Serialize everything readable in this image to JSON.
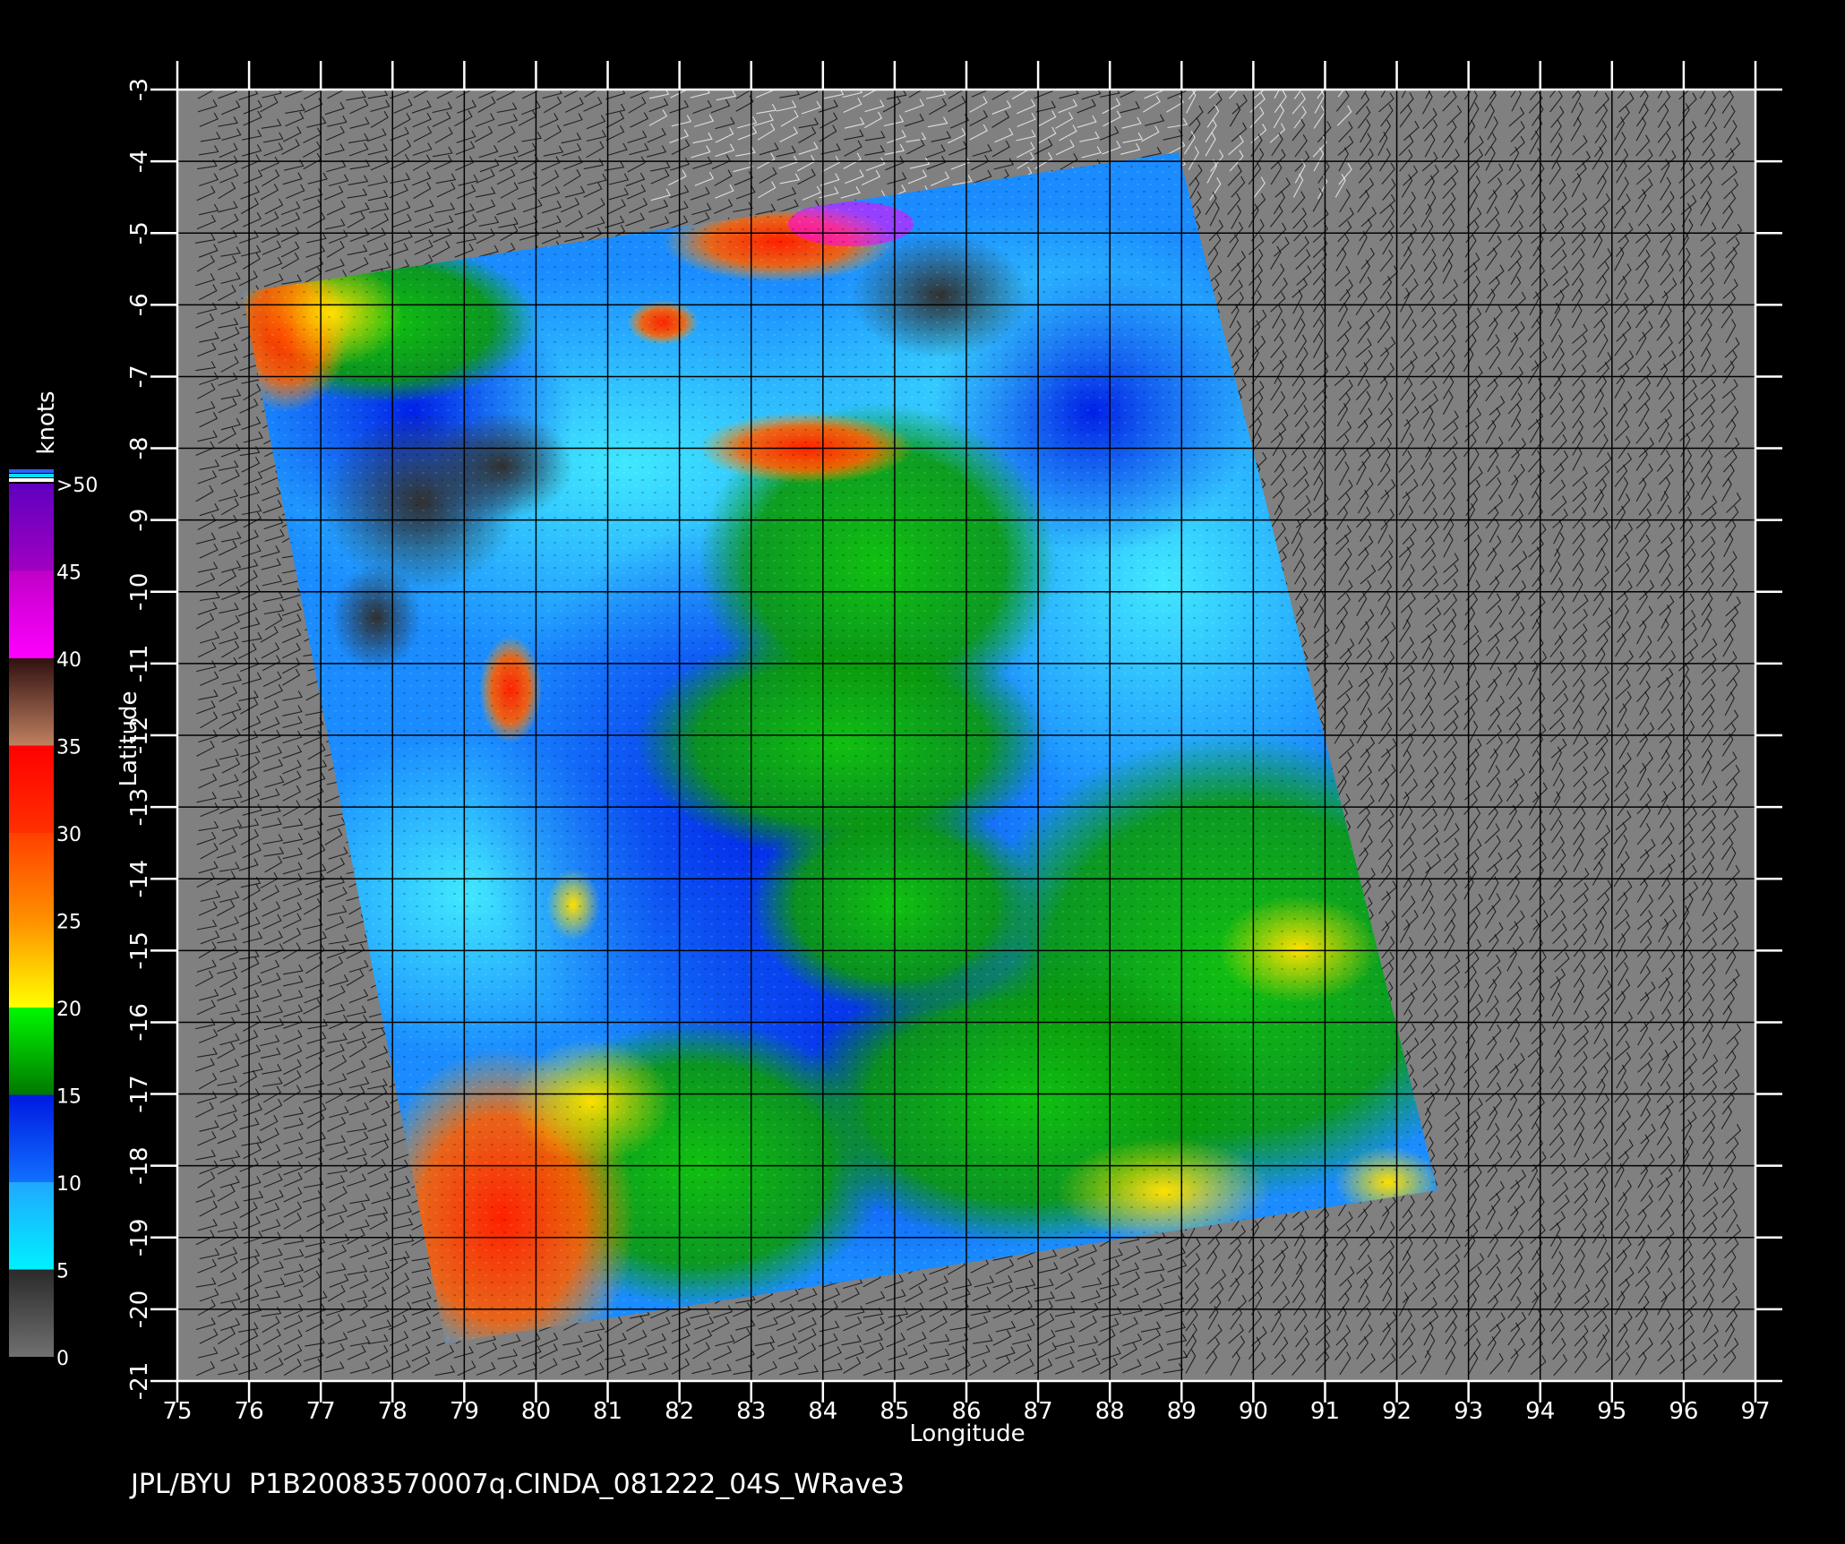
{
  "footer_text": "JPL/BYU  P1B20083570007q.CINDA_081222_04S_WRave3",
  "axes": {
    "xlabel": "Longitude",
    "ylabel": "Latitude",
    "x_ticks": [
      "75",
      "76",
      "77",
      "78",
      "79",
      "80",
      "81",
      "82",
      "83",
      "84",
      "85",
      "86",
      "87",
      "88",
      "89",
      "90",
      "91",
      "92",
      "93",
      "94",
      "95",
      "96",
      "97"
    ],
    "y_ticks": [
      "-3",
      "-4",
      "-5",
      "-6",
      "-7",
      "-8",
      "-9",
      "-10",
      "-11",
      "-12",
      "-13",
      "-14",
      "-15",
      "-16",
      "-17",
      "-18",
      "-19",
      "-20",
      "-21"
    ],
    "x_range": [
      75,
      97
    ],
    "y_range": [
      -3,
      -21
    ],
    "grid": true
  },
  "colorbar": {
    "unit": "knots",
    "labels": [
      ">50",
      "45",
      "40",
      "35",
      "30",
      "25",
      "20",
      "15",
      "10",
      "5",
      "0"
    ],
    "bands": [
      {
        "from": 0,
        "to": 5,
        "colors": [
          "#707070",
          "#2a2a2a"
        ]
      },
      {
        "from": 5,
        "to": 10,
        "colors": [
          "#00f0ff",
          "#20a8ff"
        ]
      },
      {
        "from": 10,
        "to": 15,
        "colors": [
          "#1070ff",
          "#0018e0"
        ]
      },
      {
        "from": 15,
        "to": 20,
        "colors": [
          "#007800",
          "#00f800"
        ]
      },
      {
        "from": 20,
        "to": 25,
        "colors": [
          "#ffff00",
          "#ff9000"
        ]
      },
      {
        "from": 25,
        "to": 30,
        "colors": [
          "#ff9000",
          "#ff4000"
        ]
      },
      {
        "from": 30,
        "to": 35,
        "colors": [
          "#ff3000",
          "#ff0000"
        ]
      },
      {
        "from": 35,
        "to": 40,
        "colors": [
          "#c08060",
          "#301010"
        ]
      },
      {
        "from": 40,
        "to": 45,
        "colors": [
          "#ff00ff",
          "#c000c8"
        ]
      },
      {
        "from": 45,
        "to": 50,
        "colors": [
          "#a000c0",
          "#6000c0"
        ]
      }
    ]
  },
  "colors": {
    "background": "#000000",
    "land_no_data": "#808080",
    "grid": "#000000"
  }
}
